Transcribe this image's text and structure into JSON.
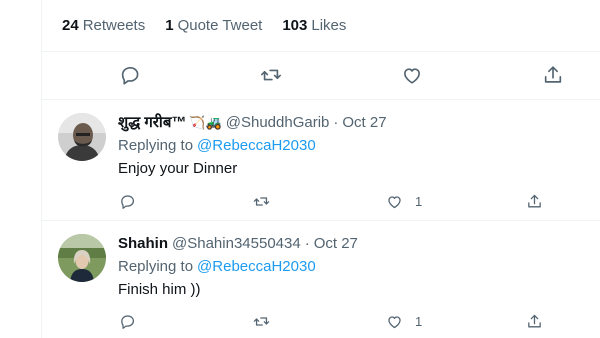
{
  "stats": [
    {
      "count": "24",
      "label": "Retweets"
    },
    {
      "count": "1",
      "label": "Quote Tweet"
    },
    {
      "count": "103",
      "label": "Likes"
    }
  ],
  "replies": [
    {
      "name": "शुद्ध गरीब™",
      "emoji": "🏹🚜",
      "handle": "@ShuddhGarib",
      "separator": "·",
      "date": "Oct 27",
      "replying_to_label": "Replying to",
      "mention": "@RebeccaH2030",
      "text": "Enjoy your Dinner",
      "like_count": "1"
    },
    {
      "name": "Shahin",
      "emoji": "",
      "handle": "@Shahin34550434",
      "separator": "·",
      "date": "Oct 27",
      "replying_to_label": "Replying to",
      "mention": "@RebeccaH2030",
      "text": "Finish him ))",
      "like_count": "1"
    }
  ],
  "icons": {
    "reply": "reply-icon",
    "retweet": "retweet-icon",
    "like": "heart-icon",
    "share": "share-icon"
  },
  "colors": {
    "link": "#1d9bf0",
    "secondary_text": "#536471",
    "border": "#eff3f4"
  }
}
